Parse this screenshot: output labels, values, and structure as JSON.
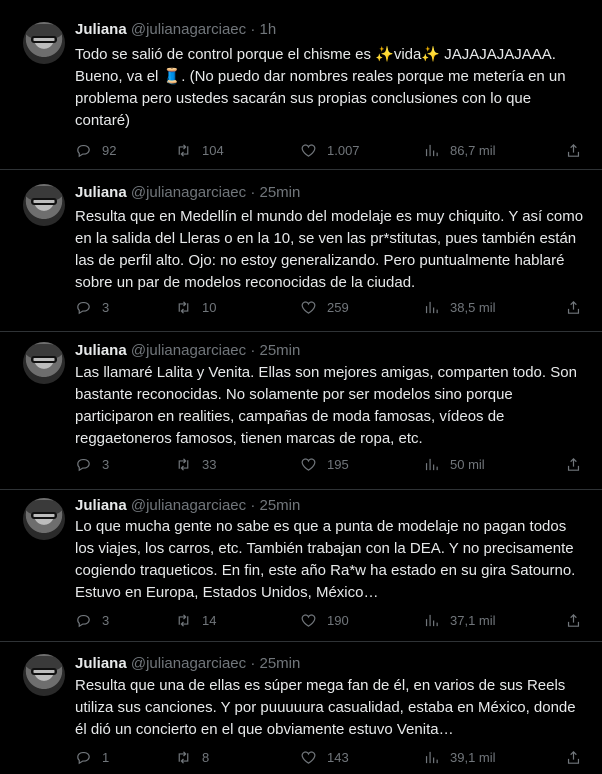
{
  "tweets": [
    {
      "name": "Juliana",
      "handle": "@julianagarciaec",
      "sep": "·",
      "time": "1h",
      "text": "Todo se salió de control porque el chisme es ✨vida✨ JAJAJAJAJAAA. Bueno, va el 🧵. (No puedo dar nombres reales porque me metería en un problema pero ustedes sacarán sus propias conclusiones con lo que contaré)",
      "replies": "92",
      "retweets": "104",
      "likes": "1.007",
      "views": "86,7 mil"
    },
    {
      "name": "Juliana",
      "handle": "@julianagarciaec",
      "sep": "·",
      "time": "25min",
      "text": "Resulta que en Medellín el mundo del modelaje es muy chiquito. Y así como en la salida del Lleras o en la 10, se ven las pr*stitutas, pues también están las de perfil alto. Ojo: no estoy generalizando. Pero puntualmente hablaré sobre un par de modelos reconocidas de la ciudad.",
      "replies": "3",
      "retweets": "10",
      "likes": "259",
      "views": "38,5 mil"
    },
    {
      "name": "Juliana",
      "handle": "@julianagarciaec",
      "sep": "·",
      "time": "25min",
      "text": "Las llamaré Lalita y Venita. Ellas son mejores amigas, comparten todo. Son bastante reconocidas. No solamente por ser modelos sino porque participaron en realities, campañas de moda famosas, vídeos de reggaetoneros famosos, tienen marcas de ropa, etc.",
      "replies": "3",
      "retweets": "33",
      "likes": "195",
      "views": "50 mil"
    },
    {
      "name": "Juliana",
      "handle": "@julianagarciaec",
      "sep": "·",
      "time": "25min",
      "text": "Lo que mucha gente no sabe es que a punta de modelaje no pagan todos los viajes, los carros, etc. También trabajan con la DEA. Y no precisamente cogiendo traqueticos. En fin, este año Ra*w ha estado en su gira Satourno. Estuvo en Europa, Estados Unidos, México…",
      "replies": "3",
      "retweets": "14",
      "likes": "190",
      "views": "37,1 mil"
    },
    {
      "name": "Juliana",
      "handle": "@julianagarciaec",
      "sep": "·",
      "time": "25min",
      "text": "Resulta que una de ellas es súper mega fan de él, en varios de sus Reels utiliza sus canciones. Y por puuuuura casualidad, estaba en México, donde él dió un concierto en el que obviamente estuvo Venita…",
      "replies": "1",
      "retweets": "8",
      "likes": "143",
      "views": "39,1 mil"
    }
  ]
}
